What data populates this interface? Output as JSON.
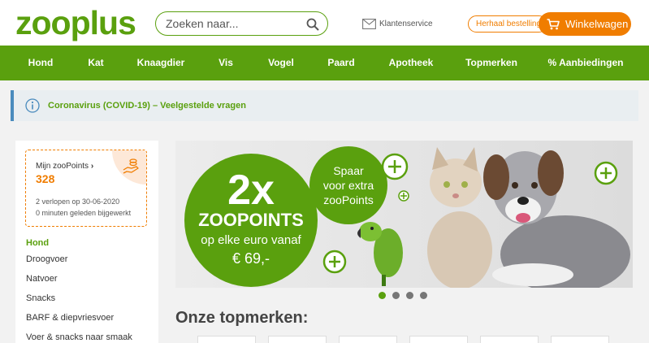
{
  "header": {
    "logo_text": "zooplus",
    "search_placeholder": "Zoeken naar...",
    "customer_service": "Klantenservice",
    "repeat_order": "Herhaal bestelling",
    "cart": "Winkelwagen"
  },
  "nav": [
    "Hond",
    "Kat",
    "Knaagdier",
    "Vis",
    "Vogel",
    "Paard",
    "Apotheek",
    "Topmerken",
    "% Aanbiedingen"
  ],
  "infobar": {
    "text": "Coronavirus (COVID-19) – Veelgestelde vragen"
  },
  "points": {
    "title": "Mijn zooPoints",
    "value": "328",
    "line1": "2 verlopen op 30-06-2020",
    "line2": "0 minuten geleden bijgewerkt"
  },
  "sidebar": {
    "heading": "Hond",
    "items": [
      "Droogvoer",
      "Natvoer",
      "Snacks",
      "BARF & diepvriesvoer",
      "Voer & snacks naar smaak"
    ]
  },
  "banner": {
    "big": "2x",
    "line1": "ZOOPOINTS",
    "line2": "op elke euro vanaf",
    "line3": "€ 69,-",
    "bubble1": "Spaar",
    "bubble2": "voor extra",
    "bubble3": "zooPoints"
  },
  "section_title": "Onze topmerken:",
  "colors": {
    "brand_green": "#5aa00e",
    "accent_orange": "#f07d00"
  }
}
